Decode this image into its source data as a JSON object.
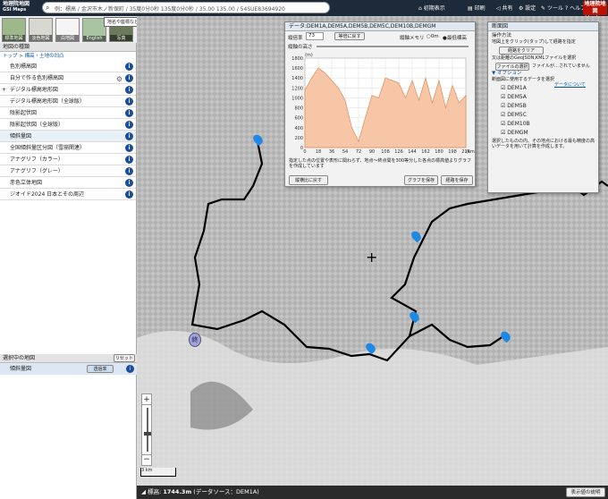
{
  "header": {
    "logo": "地理院地図",
    "logo_sub": "GSI Maps",
    "search_placeholder": "例：標高 / 金沢市木ノ新保町 / 35度0分0秒 135度0分0秒 / 35.00 135.00 / 54SUE83694920",
    "tools": [
      "初期表示",
      "印刷",
      "共有",
      "設定",
      "ツール",
      "ヘルプ"
    ],
    "vector": "地理院地図 Vector"
  },
  "tiles": {
    "items": [
      "標準地図",
      "淡色地図",
      "白地図",
      "English",
      "写真"
    ],
    "tooltip": "地名や座標などで検索できます"
  },
  "sidebar": {
    "title": "地図の種類",
    "breadcrumb": "トップ > 標高・土地の凹凸",
    "items": [
      "色別標高図",
      "自分で作る色別標高図",
      "デジタル標高地形図",
      "デジタル標高地形図（全球版）",
      "陰影起伏図",
      "陰影起伏図（全球版）",
      "傾斜量図",
      "全国傾斜量区分図（雪崩関連）",
      "アナグリフ（カラー）",
      "アナグリフ（グレー）",
      "赤色立体地図",
      "ジオイド2024 日本とその周辺"
    ],
    "selected_title": "選択中の地図",
    "reset": "リセット",
    "selected_item": "傾斜量図",
    "transparency": "透過率"
  },
  "profile": {
    "title": "データ:DEM1A,DEM5A,DEM5B,DEM5C,DEM10B,DEMGM",
    "vertical_exag_label": "縦倍率",
    "vertical_exag_value": "73",
    "reset_label": "等倍に戻す",
    "axis_min_label": "縦軸メモリ",
    "zero": "0m",
    "min_label": "最低標高",
    "height_label": "縦軸の高さ",
    "note": "指定した点の位置や表形に関わらず、地点〜終点間を300等分した各点の標高値よりグラフを作成しています",
    "return": "縦横比に戻す",
    "save_graph": "グラフを保存",
    "save_route": "経路を保存"
  },
  "chart_data": {
    "type": "area",
    "ylabel": "(m)",
    "xlabel": "(km)",
    "ylim": [
      0,
      1800
    ],
    "yticks": [
      0,
      200,
      400,
      600,
      800,
      1000,
      1200,
      1400,
      1600,
      1800
    ],
    "xticks": [
      0,
      18,
      36,
      54,
      72,
      90,
      108,
      126,
      144,
      162,
      180,
      198,
      216
    ],
    "x": [
      0,
      9,
      18,
      27,
      36,
      45,
      54,
      63,
      72,
      81,
      90,
      99,
      108,
      117,
      126,
      135,
      144,
      153,
      162,
      171,
      180,
      189,
      198,
      207,
      216
    ],
    "values": [
      1150,
      1400,
      1600,
      1500,
      1350,
      1200,
      950,
      400,
      120,
      600,
      1050,
      1000,
      1400,
      1350,
      1300,
      1000,
      1350,
      950,
      1400,
      900,
      1350,
      800,
      1250,
      900,
      1050
    ]
  },
  "panel": {
    "title": "断面図",
    "method": "操作方法",
    "method_desc": "地図上をクリック(タップ)して経路を指定",
    "clear": "経路をクリア",
    "file_desc": "又は距離のGeoJSON,KMLファイルを選択",
    "file_btn": "ファイルの選択",
    "file_none": "ファイルが…されていません",
    "options": "オプション",
    "dem_desc": "断面図に使用するデータを選択",
    "about": "データについて",
    "dems": [
      "DEM1A",
      "DEM5A",
      "DEM5B",
      "DEM5C",
      "DEM10B",
      "DEMGM"
    ],
    "note": "選択したものの内、その地点における最も精度の高いデータを用いて計算を作成します。"
  },
  "map": {
    "end_label": "終",
    "scale": "3 km"
  },
  "status": {
    "elev_label": "標高:",
    "elev_value": "1744.3m",
    "source": "(データソース：DEM1A)",
    "desc_btn": "表示値の説明"
  }
}
